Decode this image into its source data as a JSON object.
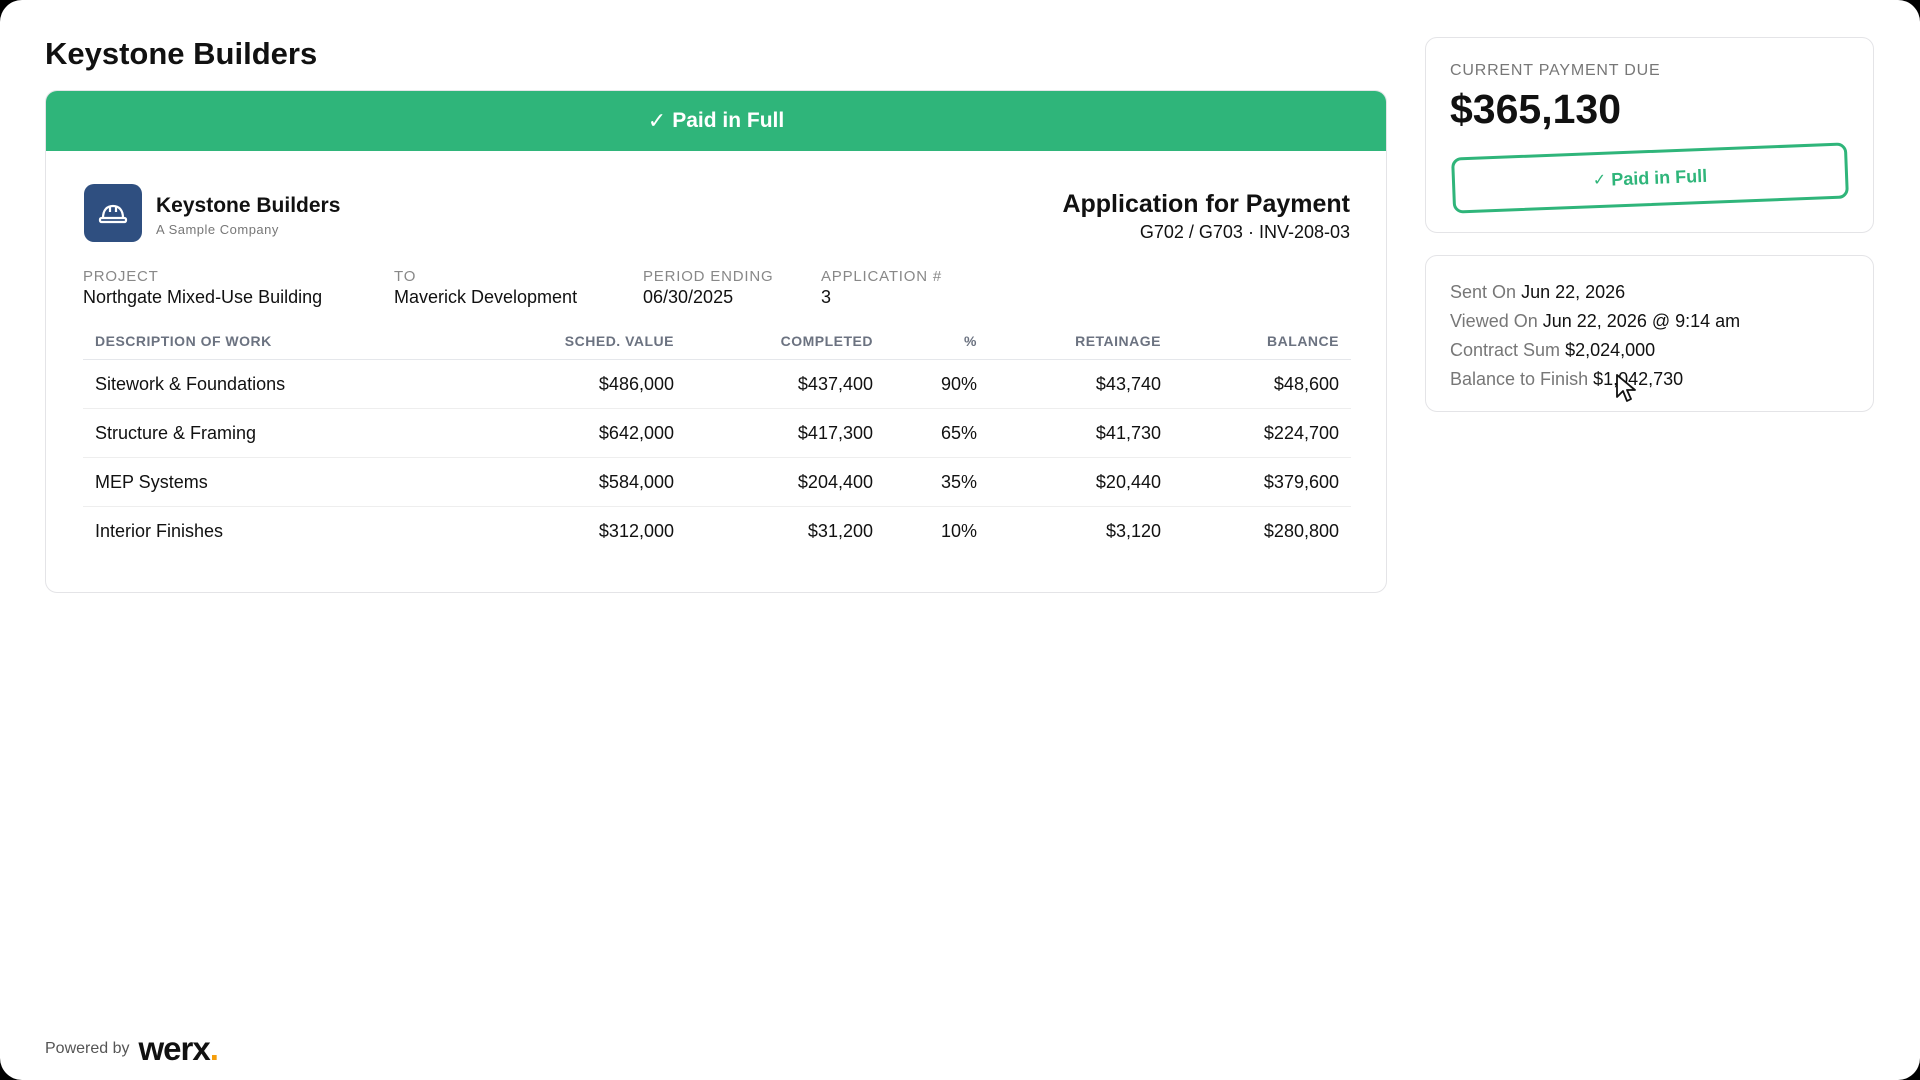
{
  "page": {
    "title": "Keystone Builders"
  },
  "invoice": {
    "banner": "Paid in Full",
    "banner_icon": "check-icon",
    "brand": {
      "name": "Keystone Builders",
      "tagline": "A Sample Company",
      "logo_icon": "hard-hat-icon",
      "logo_color": "#2f4f80"
    },
    "doc_title": "Application for Payment",
    "doc_subtitle": "G702 / G703 · INV-208-03",
    "meta": {
      "project": {
        "label": "PROJECT",
        "value": "Northgate Mixed-Use Building"
      },
      "to": {
        "label": "TO",
        "value": "Maverick Development"
      },
      "period": {
        "label": "PERIOD ENDING",
        "value": "06/30/2025"
      },
      "app_no": {
        "label": "APPLICATION #",
        "value": "3"
      }
    },
    "table": {
      "headers": [
        "DESCRIPTION OF WORK",
        "SCHED. VALUE",
        "COMPLETED",
        "%",
        "RETAINAGE",
        "BALANCE"
      ],
      "rows": [
        [
          "Sitework & Foundations",
          "$486,000",
          "$437,400",
          "90%",
          "$43,740",
          "$48,600"
        ],
        [
          "Structure & Framing",
          "$642,000",
          "$417,300",
          "65%",
          "$41,730",
          "$224,700"
        ],
        [
          "MEP Systems",
          "$584,000",
          "$204,400",
          "35%",
          "$20,440",
          "$379,600"
        ],
        [
          "Interior Finishes",
          "$312,000",
          "$31,200",
          "10%",
          "$3,120",
          "$280,800"
        ]
      ]
    }
  },
  "payment": {
    "label": "CURRENT PAYMENT DUE",
    "amount": "$365,130",
    "stamp": "Paid in Full",
    "accent": "#2fb57a"
  },
  "details": {
    "sent": {
      "label": "Sent On",
      "value": "Jun 22, 2026"
    },
    "viewed": {
      "label": "Viewed On",
      "value": "Jun 22, 2026 @ 9:14 am"
    },
    "contract": {
      "label": "Contract Sum",
      "value": "$2,024,000"
    },
    "balance": {
      "label": "Balance to Finish",
      "value": "$1,042,730"
    }
  },
  "footer": {
    "powered_by": "Powered by",
    "brand": "werx",
    "brand_dot": "."
  }
}
